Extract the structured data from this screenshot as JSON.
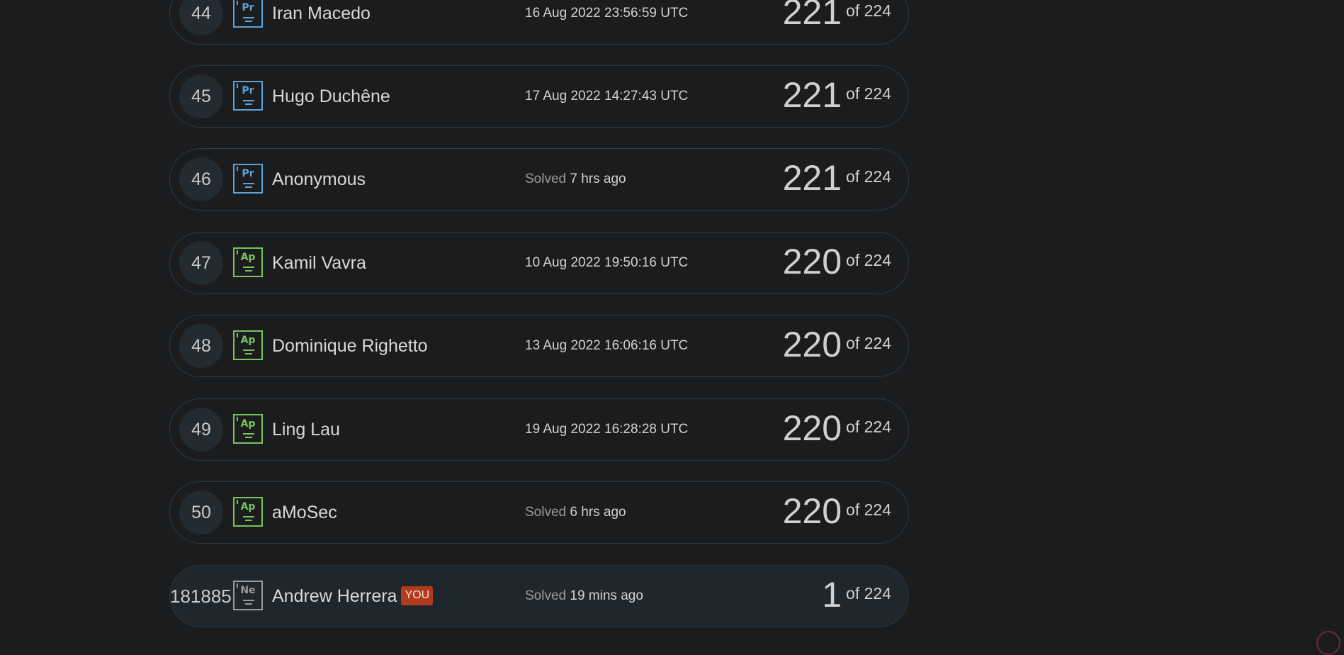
{
  "leaderboard": {
    "rows": [
      {
        "rank": "44",
        "badge": "Pr",
        "badge_color": "#5ea2d8",
        "name": "Iran Macedo",
        "solved_label": "",
        "date": "16 Aug 2022 23:56:59 UTC",
        "score": "221",
        "of_label": "of 224"
      },
      {
        "rank": "45",
        "badge": "Pr",
        "badge_color": "#5ea2d8",
        "name": "Hugo Duchêne",
        "solved_label": "",
        "date": "17 Aug 2022 14:27:43 UTC",
        "score": "221",
        "of_label": "of 224"
      },
      {
        "rank": "46",
        "badge": "Pr",
        "badge_color": "#5ea2d8",
        "name": "Anonymous",
        "solved_label": "Solved",
        "date": "7 hrs ago",
        "score": "221",
        "of_label": "of 224"
      },
      {
        "rank": "47",
        "badge": "Ap",
        "badge_color": "#78c35a",
        "name": "Kamil Vavra",
        "solved_label": "",
        "date": "10 Aug 2022 19:50:16 UTC",
        "score": "220",
        "of_label": "of 224"
      },
      {
        "rank": "48",
        "badge": "Ap",
        "badge_color": "#78c35a",
        "name": "Dominique Righetto",
        "solved_label": "",
        "date": "13 Aug 2022 16:06:16 UTC",
        "score": "220",
        "of_label": "of 224"
      },
      {
        "rank": "49",
        "badge": "Ap",
        "badge_color": "#78c35a",
        "name": "Ling Lau",
        "solved_label": "",
        "date": "19 Aug 2022 16:28:28 UTC",
        "score": "220",
        "of_label": "of 224"
      },
      {
        "rank": "50",
        "badge": "Ap",
        "badge_color": "#78c35a",
        "name": "aMoSec",
        "solved_label": "Solved",
        "date": "6 hrs ago",
        "score": "220",
        "of_label": "of 224"
      }
    ],
    "current_user": {
      "rank": "181885",
      "badge": "Ne",
      "badge_color": "#9a9a9a",
      "name": "Andrew Herrera",
      "you_tag": "YOU",
      "solved_label": "Solved",
      "date": "19 mins ago",
      "score": "1",
      "of_label": "of 224"
    }
  }
}
